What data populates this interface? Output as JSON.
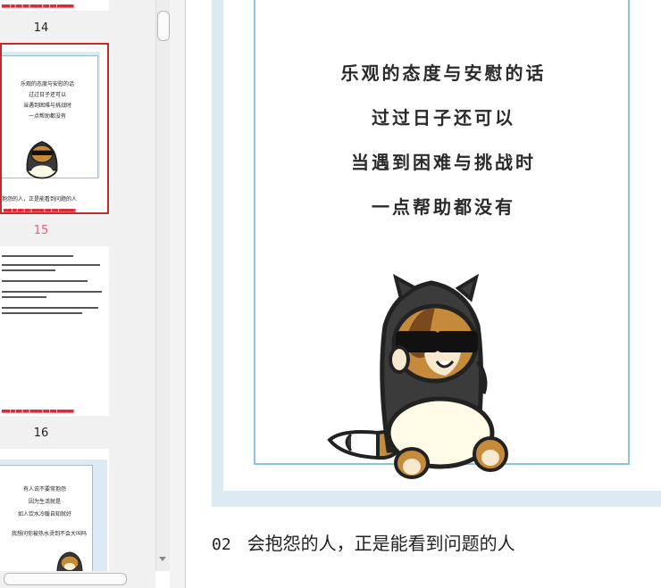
{
  "thumbnails": {
    "pages": [
      {
        "number": "14",
        "active": false
      },
      {
        "number": "15",
        "active": true
      },
      {
        "number": "16",
        "active": false
      }
    ],
    "thumb15_poem": [
      "乐观的态度与安慰的话",
      "过过日子还可以",
      "当遇到困难与挑战时",
      "一点帮助都没有"
    ],
    "thumb15_caption": "抱怨的人，正是能看到问题的人",
    "thumb16_poem": [
      "有人说不要常抱怨",
      "因为生活就是",
      "如人饮水冷暖自知就好",
      "我想问你被热水烫到不会大叫吗"
    ]
  },
  "slide": {
    "poem_lines": [
      "乐观的态度与安慰的话",
      "过过日子还可以",
      "当遇到困难与挑战时",
      "一点帮助都没有"
    ],
    "illustration": "cat-in-hood-with-sunglasses"
  },
  "heading": {
    "number": "02",
    "text": "会抱怨的人，正是能看到问题的人"
  },
  "colors": {
    "frame_border": "#8ec2d6",
    "frame_bg": "#dcebf3",
    "active_page": "#e8607a"
  }
}
